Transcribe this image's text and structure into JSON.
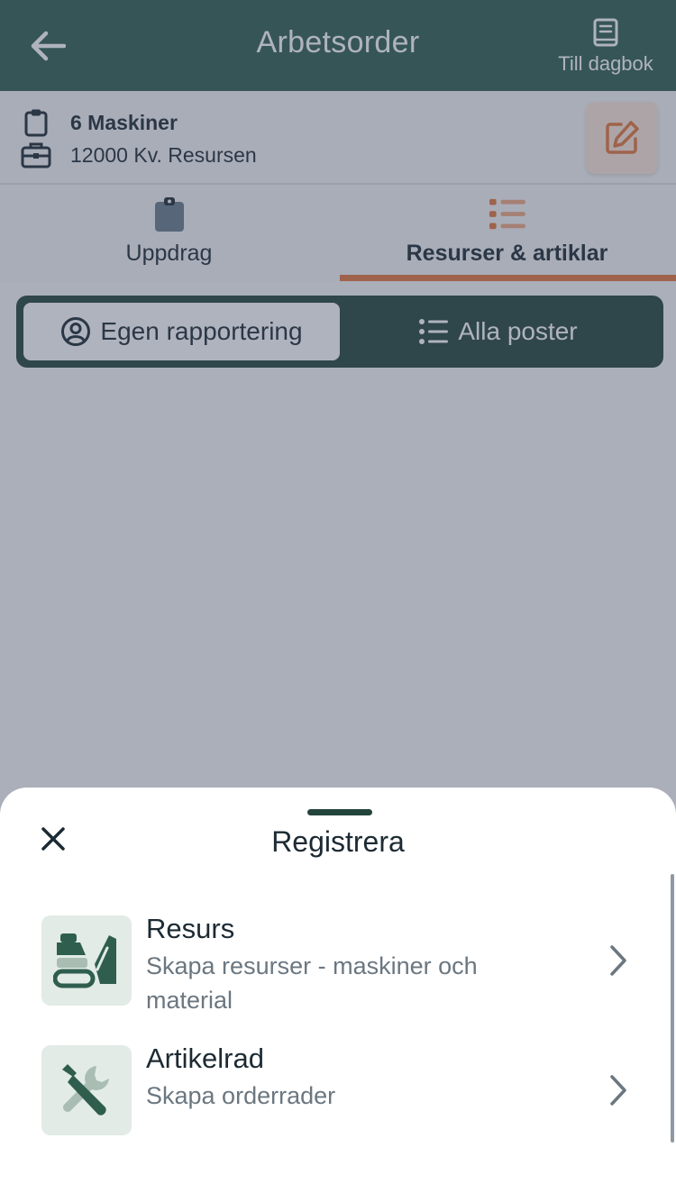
{
  "header": {
    "title": "Arbetsorder",
    "back_icon": "arrow-left-icon",
    "diary_label": "Till dagbok",
    "diary_icon": "book-icon"
  },
  "info": {
    "line1": "6 Maskiner",
    "line1_icon": "clipboard-icon",
    "line2": "12000 Kv. Resursen",
    "line2_icon": "briefcase-icon",
    "edit_icon": "edit-icon"
  },
  "tabs": [
    {
      "label": "Uppdrag",
      "icon": "clipboard-icon",
      "active": false
    },
    {
      "label": "Resurser & artiklar",
      "icon": "list-icon",
      "active": true
    }
  ],
  "segment": {
    "own": "Egen rapportering",
    "own_icon": "user-circle-icon",
    "all": "Alla poster",
    "all_icon": "list-icon"
  },
  "sheet": {
    "title": "Registrera",
    "close_icon": "close-icon",
    "options": [
      {
        "title": "Resurs",
        "subtitle": "Skapa resurser - maskiner och material",
        "icon": "excavator-icon"
      },
      {
        "title": "Artikelrad",
        "subtitle": "Skapa orderrader",
        "icon": "tools-icon"
      }
    ]
  },
  "colors": {
    "header": "#2f5e4f",
    "accent": "#e2753a",
    "segment_bg": "#23443a",
    "icon_tile": "#e2ebe6"
  }
}
